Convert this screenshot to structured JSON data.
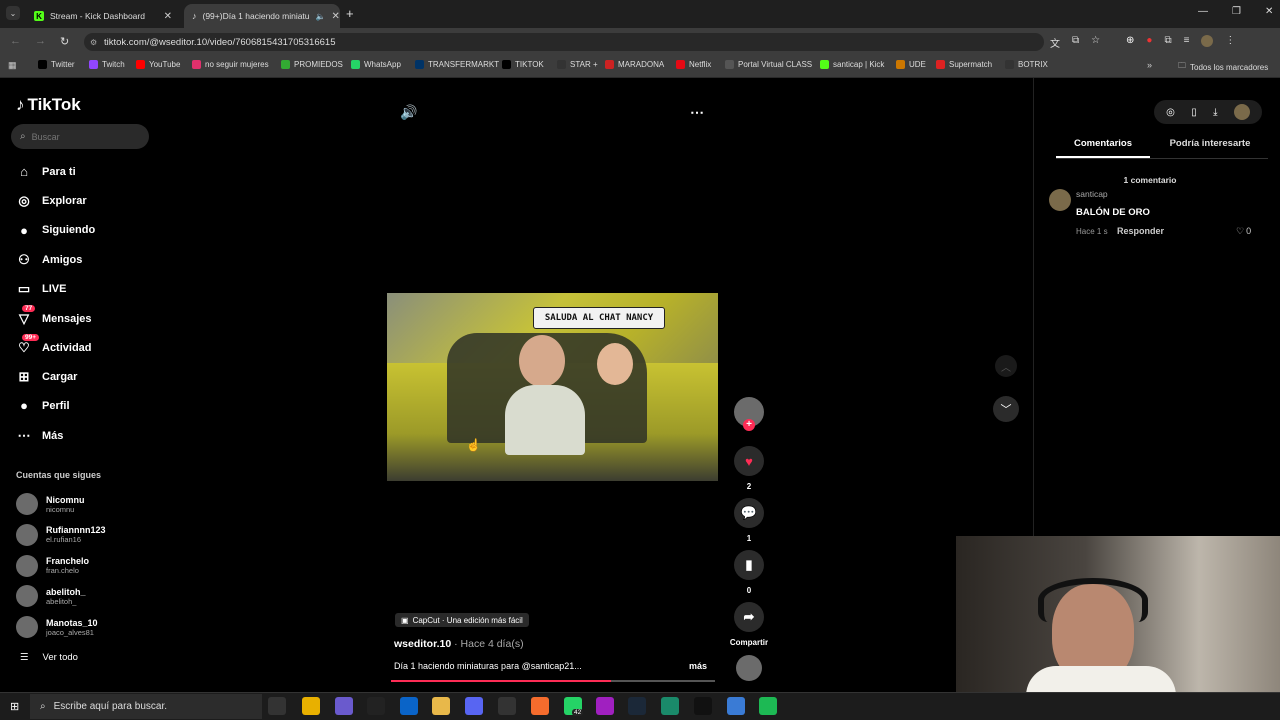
{
  "browser": {
    "tabs": [
      {
        "title": "Stream - Kick Dashboard"
      },
      {
        "title": "(99+)Día 1 haciendo miniatu"
      }
    ],
    "url": "tiktok.com/@wseditor.10/video/7606815431705316615",
    "bookmarks": [
      "Twitter",
      "Twitch",
      "YouTube",
      "no seguir mujeres",
      "PROMIEDOS",
      "WhatsApp",
      "TRANSFERMARKT",
      "TIKTOK",
      "STAR +",
      "MARADONA",
      "Netflix",
      "Portal Virtual CLASS",
      "santicap | Kick",
      "UDE",
      "Supermatch",
      "BOTRIX"
    ],
    "all_bookmarks": "Todos los marcadores"
  },
  "tiktok": {
    "logo": "TikTok",
    "search_placeholder": "Buscar",
    "nav": [
      {
        "label": "Para ti",
        "icon": "home-icon"
      },
      {
        "label": "Explorar",
        "icon": "compass-icon"
      },
      {
        "label": "Siguiendo",
        "icon": "following-icon"
      },
      {
        "label": "Amigos",
        "icon": "friends-icon"
      },
      {
        "label": "LIVE",
        "icon": "live-icon"
      },
      {
        "label": "Mensajes",
        "icon": "messages-icon",
        "badge": "77"
      },
      {
        "label": "Actividad",
        "icon": "activity-icon",
        "badge": "99+"
      },
      {
        "label": "Cargar",
        "icon": "upload-icon"
      },
      {
        "label": "Perfil",
        "icon": "profile-icon"
      },
      {
        "label": "Más",
        "icon": "more-icon"
      }
    ],
    "following_title": "Cuentas que sigues",
    "following": [
      {
        "name": "Nicomnu",
        "handle": "nicomnu"
      },
      {
        "name": "Rufiannnn123",
        "handle": "el.rufian16"
      },
      {
        "name": "Franchelo",
        "handle": "fran.chelo"
      },
      {
        "name": "abelitoh_",
        "handle": "abelitoh_"
      },
      {
        "name": "Manotas_10",
        "handle": "joaco_alves81"
      }
    ],
    "see_all": "Ver todo",
    "video": {
      "sign_text": "SALUDA AL CHAT NANCY",
      "capcut": "CapCut · Una edición más fácil",
      "author": "wseditor.10",
      "time": " · Hace 4 día(s)",
      "caption": "Día 1 haciendo miniaturas para @santicap21...",
      "more": "más",
      "likes": "2",
      "comments": "1",
      "saves": "0",
      "share": "Compartir"
    },
    "tabs": {
      "comments": "Comentarios",
      "suggested": "Podría interesarte"
    },
    "comment_count": "1 comentario",
    "comment": {
      "user": "santicap",
      "text": "BALÓN DE ORO",
      "time": "Hace 1 s",
      "reply": "Responder",
      "likes": "0"
    }
  },
  "taskbar": {
    "search": "Escribe aquí para buscar.",
    "whatsapp_badge": "42"
  }
}
